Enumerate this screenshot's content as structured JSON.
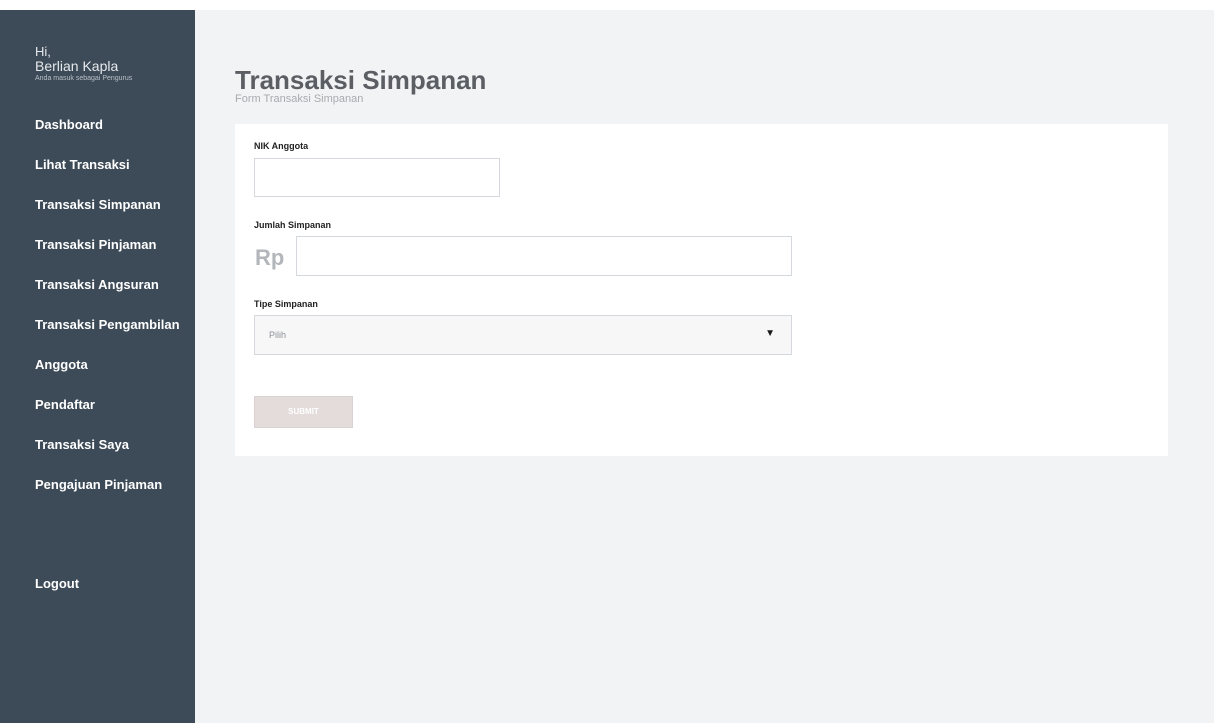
{
  "sidebar": {
    "greeting": "Hi,",
    "user_name": "Berlian Kapla",
    "role_text": "Anda masuk sebagai Pengurus",
    "items": [
      {
        "label": "Dashboard"
      },
      {
        "label": "Lihat Transaksi"
      },
      {
        "label": "Transaksi Simpanan"
      },
      {
        "label": "Transaksi Pinjaman"
      },
      {
        "label": "Transaksi Angsuran"
      },
      {
        "label": "Transaksi Pengambilan"
      },
      {
        "label": "Anggota"
      },
      {
        "label": "Pendaftar"
      },
      {
        "label": "Transaksi Saya"
      },
      {
        "label": "Pengajuan Pinjaman"
      }
    ],
    "logout_label": "Logout"
  },
  "main": {
    "title": "Transaksi Simpanan",
    "subtitle": "Form Transaksi Simpanan"
  },
  "form": {
    "nik_label": "NIK Anggota",
    "nik_value": "",
    "amount_label": "Jumlah Simpanan",
    "amount_prefix": "Rp",
    "amount_value": "",
    "type_label": "Tipe Simpanan",
    "type_selected": "Pilih",
    "submit_label": "SUBMIT"
  },
  "colors": {
    "sidebar_bg": "#3d4a57",
    "main_bg": "#f2f3f5",
    "card_bg": "#ffffff",
    "submit_bg": "#e3dcdb"
  },
  "icons": {
    "select_arrow": "caret-down-icon"
  }
}
